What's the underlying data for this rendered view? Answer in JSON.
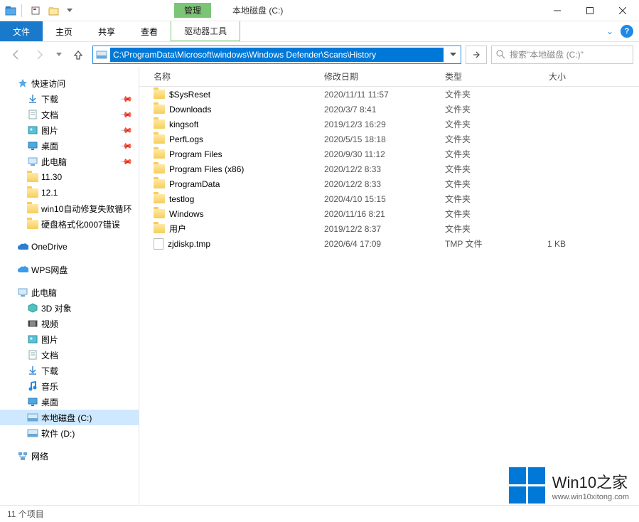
{
  "window": {
    "title": "本地磁盘 (C:)",
    "manage_label": "管理"
  },
  "ribbon": {
    "file": "文件",
    "home": "主页",
    "share": "共享",
    "view": "查看",
    "drive_tool": "驱动器工具"
  },
  "address": {
    "path": "C:\\ProgramData\\Microsoft\\windows\\Windows Defender\\Scans\\History",
    "search_placeholder": "搜索\"本地磁盘 (C:)\""
  },
  "columns": {
    "name": "名称",
    "date": "修改日期",
    "type": "类型",
    "size": "大小"
  },
  "sidebar": {
    "quick_access": "快速访问",
    "quick_items": [
      {
        "label": "下载",
        "icon": "download",
        "pin": true
      },
      {
        "label": "文档",
        "icon": "doc",
        "pin": true
      },
      {
        "label": "图片",
        "icon": "pic",
        "pin": true
      },
      {
        "label": "桌面",
        "icon": "desktop",
        "pin": true
      },
      {
        "label": "此电脑",
        "icon": "pc",
        "pin": true
      },
      {
        "label": "11.30",
        "icon": "folder",
        "pin": false
      },
      {
        "label": "12.1",
        "icon": "folder",
        "pin": false
      },
      {
        "label": "win10自动修复失败循环",
        "icon": "folder",
        "pin": false
      },
      {
        "label": "硬盘格式化0007错误",
        "icon": "folder",
        "pin": false
      }
    ],
    "onedrive": "OneDrive",
    "wps": "WPS网盘",
    "this_pc": "此电脑",
    "pc_items": [
      {
        "label": "3D 对象",
        "icon": "3d"
      },
      {
        "label": "视频",
        "icon": "video"
      },
      {
        "label": "图片",
        "icon": "pic"
      },
      {
        "label": "文档",
        "icon": "doc"
      },
      {
        "label": "下载",
        "icon": "download"
      },
      {
        "label": "音乐",
        "icon": "music"
      },
      {
        "label": "桌面",
        "icon": "desktop"
      },
      {
        "label": "本地磁盘 (C:)",
        "icon": "drive",
        "selected": true
      },
      {
        "label": "软件 (D:)",
        "icon": "drive"
      }
    ],
    "network": "网络"
  },
  "files": [
    {
      "name": "$SysReset",
      "date": "2020/11/11 11:57",
      "type": "文件夹",
      "size": "",
      "icon": "folder"
    },
    {
      "name": "Downloads",
      "date": "2020/3/7 8:41",
      "type": "文件夹",
      "size": "",
      "icon": "folder"
    },
    {
      "name": "kingsoft",
      "date": "2019/12/3 16:29",
      "type": "文件夹",
      "size": "",
      "icon": "folder"
    },
    {
      "name": "PerfLogs",
      "date": "2020/5/15 18:18",
      "type": "文件夹",
      "size": "",
      "icon": "folder"
    },
    {
      "name": "Program Files",
      "date": "2020/9/30 11:12",
      "type": "文件夹",
      "size": "",
      "icon": "folder"
    },
    {
      "name": "Program Files (x86)",
      "date": "2020/12/2 8:33",
      "type": "文件夹",
      "size": "",
      "icon": "folder"
    },
    {
      "name": "ProgramData",
      "date": "2020/12/2 8:33",
      "type": "文件夹",
      "size": "",
      "icon": "folder"
    },
    {
      "name": "testlog",
      "date": "2020/4/10 15:15",
      "type": "文件夹",
      "size": "",
      "icon": "folder"
    },
    {
      "name": "Windows",
      "date": "2020/11/16 8:21",
      "type": "文件夹",
      "size": "",
      "icon": "folder"
    },
    {
      "name": "用户",
      "date": "2019/12/2 8:37",
      "type": "文件夹",
      "size": "",
      "icon": "folder"
    },
    {
      "name": "zjdiskp.tmp",
      "date": "2020/6/4 17:09",
      "type": "TMP 文件",
      "size": "1 KB",
      "icon": "file"
    }
  ],
  "status": {
    "count": "11 个项目"
  },
  "watermark": {
    "title": "Win10之家",
    "url": "www.win10xitong.com"
  }
}
